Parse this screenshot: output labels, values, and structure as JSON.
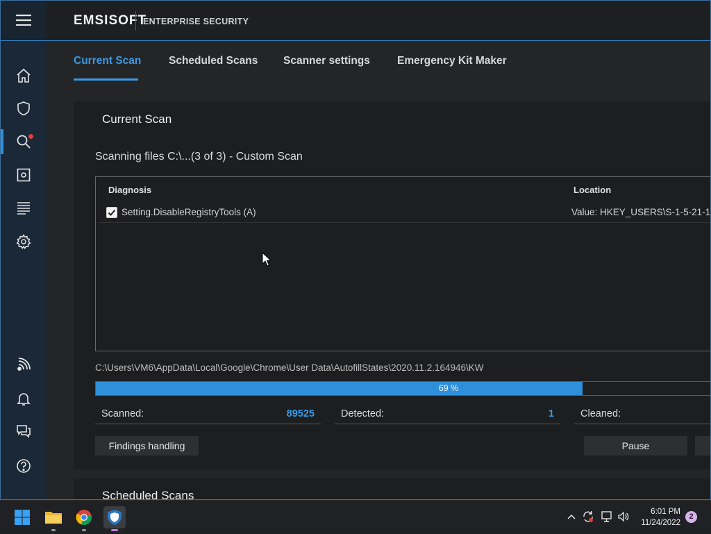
{
  "app": {
    "brand": "EMSISOFT",
    "product": "ENTERPRISE SECURITY"
  },
  "tabs": [
    {
      "label": "Current Scan",
      "active": true
    },
    {
      "label": "Scheduled Scans",
      "active": false
    },
    {
      "label": "Scanner settings",
      "active": false
    },
    {
      "label": "Emergency Kit Maker",
      "active": false
    }
  ],
  "sidebar": {
    "items": [
      {
        "icon": "home-icon"
      },
      {
        "icon": "shield-icon"
      },
      {
        "icon": "search-icon",
        "active": true,
        "notification": true
      },
      {
        "icon": "safe-icon"
      },
      {
        "icon": "log-list-icon"
      },
      {
        "icon": "gear-icon"
      },
      {
        "icon": "wireless-network-icon"
      },
      {
        "icon": "bell-icon"
      },
      {
        "icon": "chat-icon"
      },
      {
        "icon": "help-icon"
      }
    ]
  },
  "panel": {
    "title": "Current Scan",
    "status": "Scanning files C:\\...(3 of 3) - Custom Scan",
    "columns": {
      "diagnosis": "Diagnosis",
      "location": "Location"
    },
    "findings": [
      {
        "checked": true,
        "name": "Setting.DisableRegistryTools (A)",
        "location": "Value: HKEY_USERS\\S-1-5-21-1..."
      }
    ],
    "current_path": "C:\\Users\\VM6\\AppData\\Local\\Google\\Chrome\\User Data\\AutofillStates\\2020.11.2.164946\\KW",
    "progress_percent": 69,
    "progress_label": "69 %",
    "stats": {
      "scanned_label": "Scanned:",
      "scanned_value": "89525",
      "detected_label": "Detected:",
      "detected_value": "1",
      "cleaned_label": "Cleaned:"
    },
    "buttons": {
      "findings": "Findings handling",
      "pause": "Pause"
    }
  },
  "next_section": {
    "title": "Scheduled Scans"
  },
  "taskbar": {
    "time": "6:01 PM",
    "date": "11/24/2022",
    "notifications": "2"
  },
  "colors": {
    "accent": "#2f8fd8",
    "notification": "#e0403a"
  }
}
